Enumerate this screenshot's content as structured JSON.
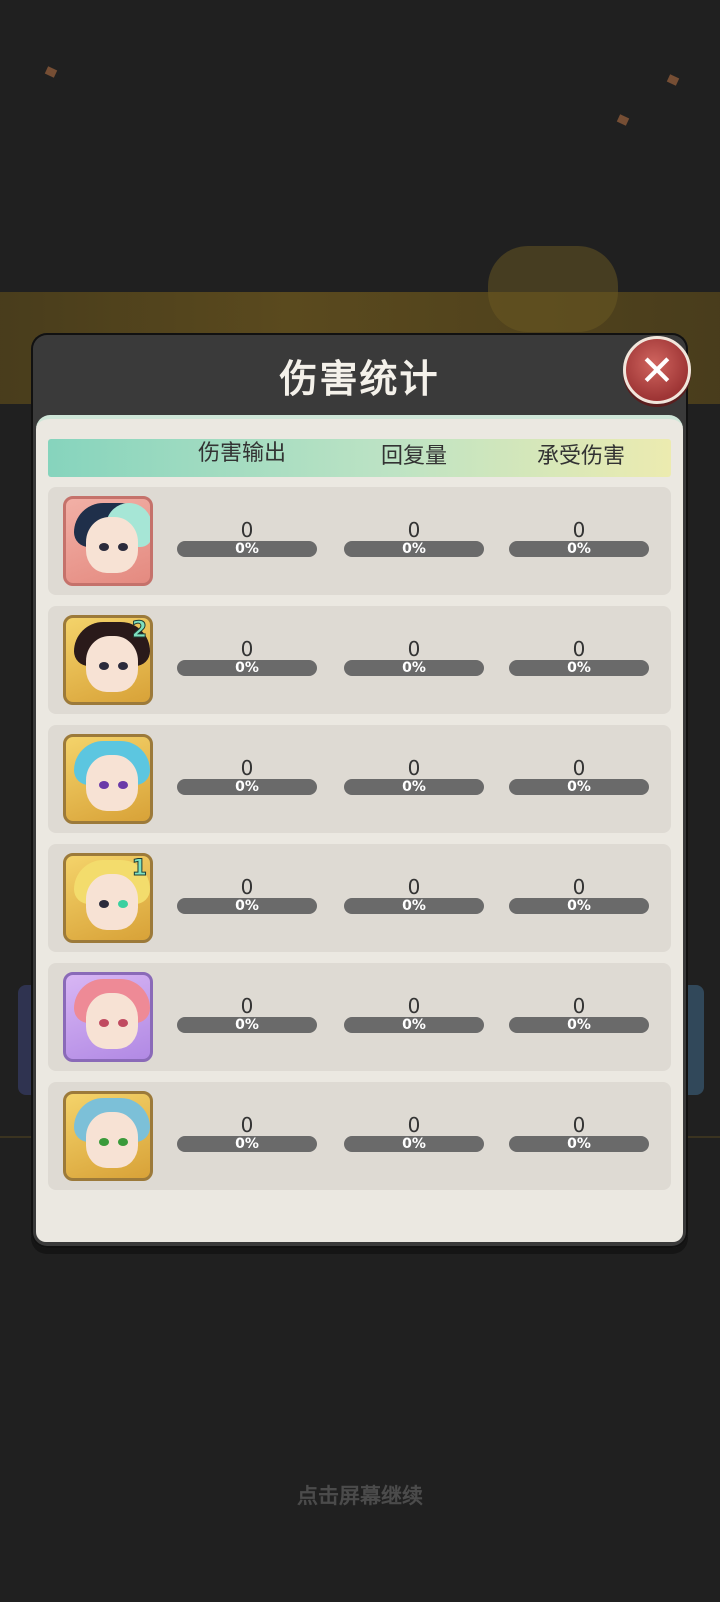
{
  "dialog": {
    "title": "伤害统计",
    "close_icon": "close-icon",
    "columns": [
      "伤害输出",
      "回复量",
      "承受伤害"
    ]
  },
  "heroes": [
    {
      "avatar": "hero-avatar-1",
      "level_badge": "",
      "damage": "0",
      "damage_pct": "0%",
      "heal": "0",
      "heal_pct": "0%",
      "taken": "0",
      "taken_pct": "0%"
    },
    {
      "avatar": "hero-avatar-2",
      "level_badge": "2",
      "damage": "0",
      "damage_pct": "0%",
      "heal": "0",
      "heal_pct": "0%",
      "taken": "0",
      "taken_pct": "0%"
    },
    {
      "avatar": "hero-avatar-3",
      "level_badge": "",
      "damage": "0",
      "damage_pct": "0%",
      "heal": "0",
      "heal_pct": "0%",
      "taken": "0",
      "taken_pct": "0%"
    },
    {
      "avatar": "hero-avatar-4",
      "level_badge": "1",
      "damage": "0",
      "damage_pct": "0%",
      "heal": "0",
      "heal_pct": "0%",
      "taken": "0",
      "taken_pct": "0%"
    },
    {
      "avatar": "hero-avatar-5",
      "level_badge": "",
      "damage": "0",
      "damage_pct": "0%",
      "heal": "0",
      "heal_pct": "0%",
      "taken": "0",
      "taken_pct": "0%"
    },
    {
      "avatar": "hero-avatar-6",
      "level_badge": "",
      "damage": "0",
      "damage_pct": "0%",
      "heal": "0",
      "heal_pct": "0%",
      "taken": "0",
      "taken_pct": "0%"
    }
  ],
  "progress_fraction": 0,
  "footer": {
    "continue_hint": "点击屏幕继续"
  },
  "colors": {
    "accent": "#86d4bd",
    "close": "#b84646",
    "panel": "#3a3a3a",
    "body": "#ebe8e1"
  }
}
